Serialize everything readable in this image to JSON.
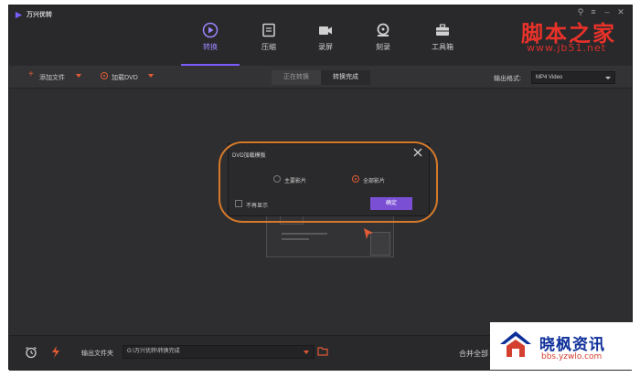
{
  "app": {
    "title": "万兴优转"
  },
  "nav": [
    {
      "label": "转换",
      "icon": "convert-icon",
      "active": true
    },
    {
      "label": "压缩",
      "icon": "compress-icon",
      "active": false
    },
    {
      "label": "录屏",
      "icon": "record-screen-icon",
      "active": false
    },
    {
      "label": "刻录",
      "icon": "burn-disc-icon",
      "active": false
    },
    {
      "label": "工具箱",
      "icon": "toolbox-icon",
      "active": false
    }
  ],
  "watermark": {
    "text": "脚本之家",
    "url": "www.jb51.net"
  },
  "toolbar": {
    "add_file": "添加文件",
    "load_dvd": "加载DVD",
    "tab_converting": "正在转换",
    "tab_done": "转换完成",
    "format_label": "输出格式:",
    "format_value": "MP4 Video"
  },
  "dialog": {
    "title": "DVD加载模板",
    "option_main": "主要影片",
    "option_all": "全部影片",
    "selected": "全部影片",
    "dont_show": "不再显示",
    "ok": "确定"
  },
  "bottom": {
    "output_label": "输出文件夹",
    "output_path": "G:\\万兴优转\\转换完成",
    "merge_label": "合并全部"
  },
  "brand": {
    "name": "晓枫资讯",
    "url": "bbs.yzwlo.com"
  },
  "colors": {
    "accent": "#7b5cff",
    "orange": "#e15b35",
    "highlight": "#d67a2a",
    "ok": "#7a4fd4"
  }
}
